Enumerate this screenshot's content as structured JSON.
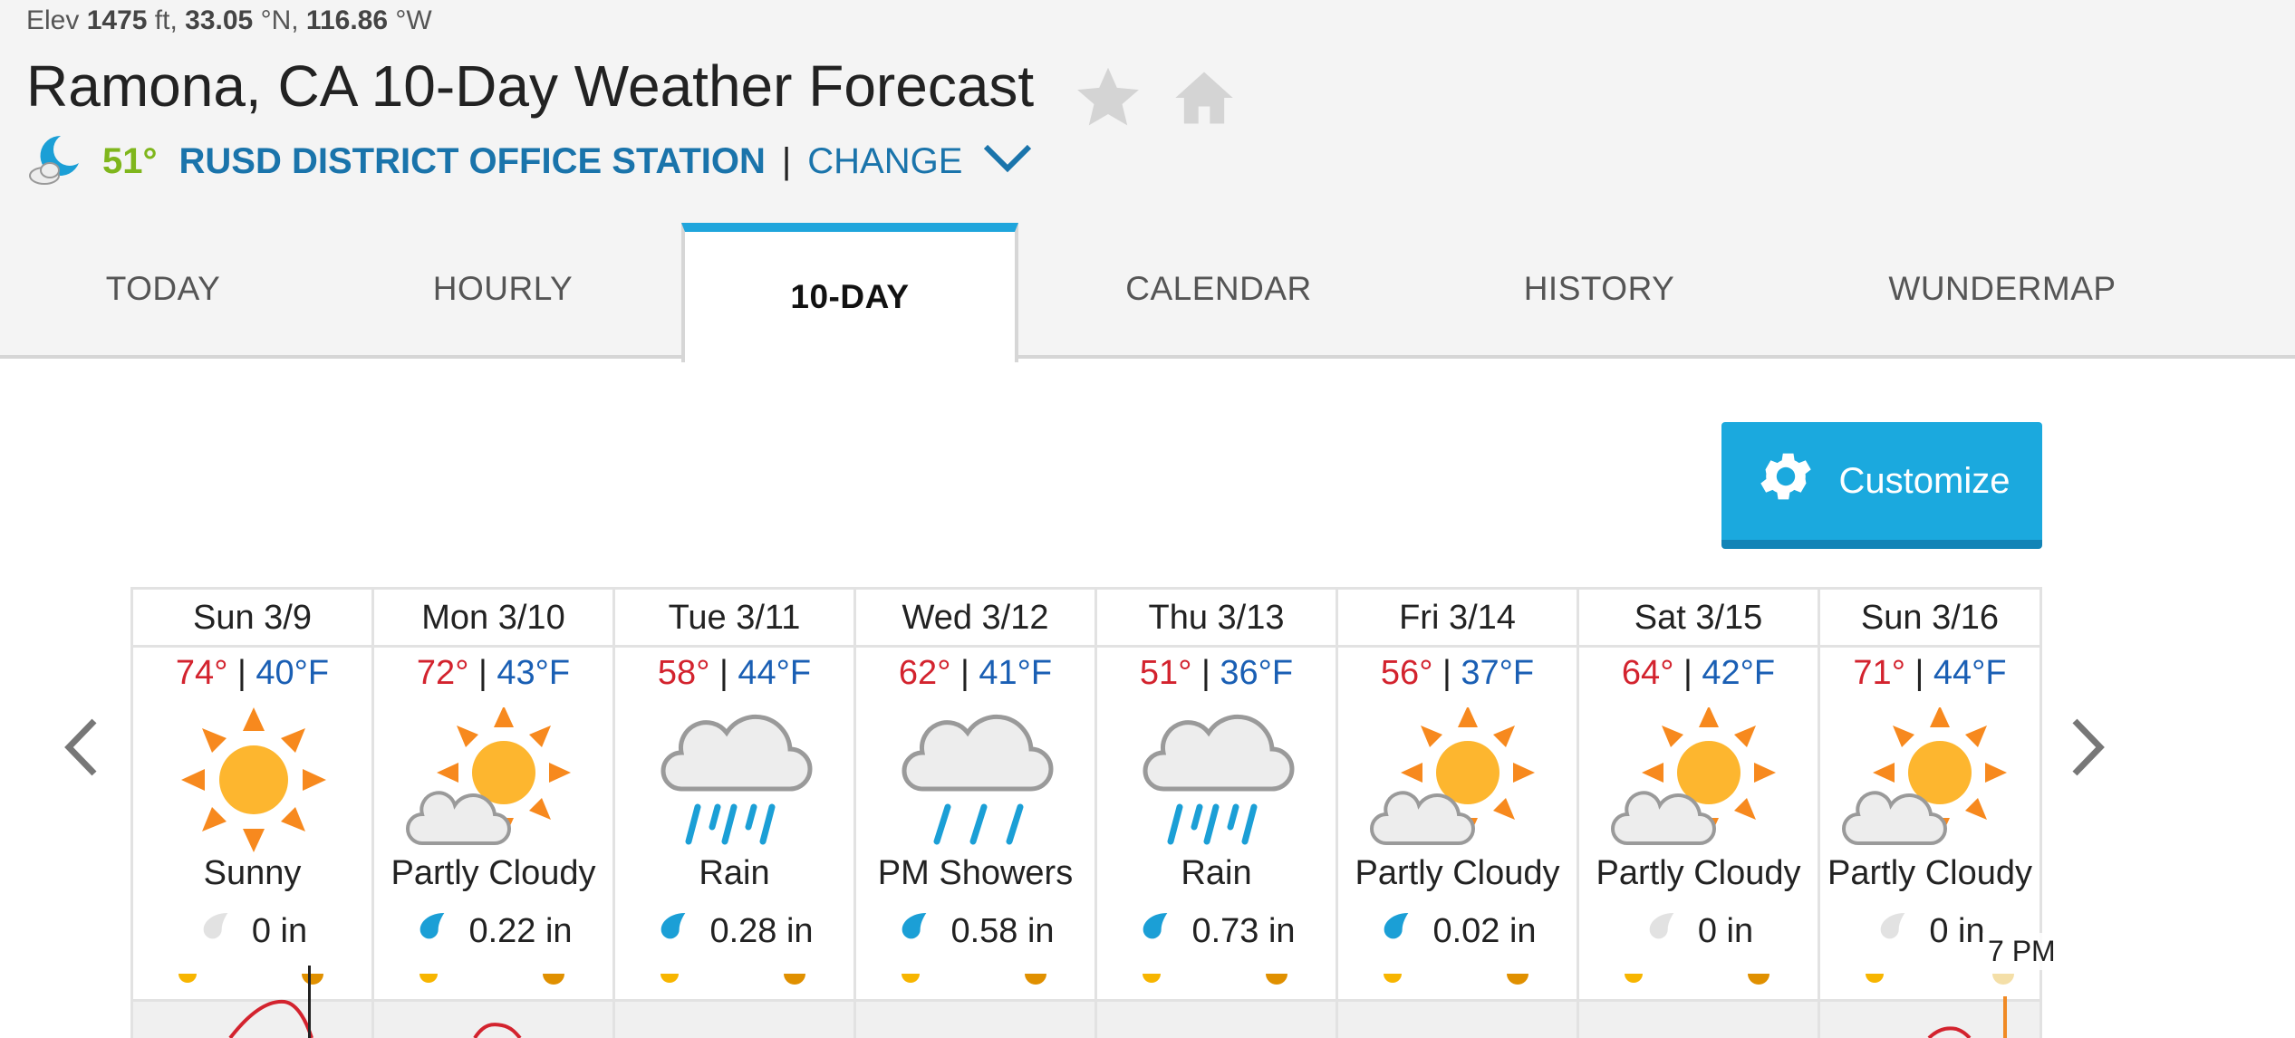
{
  "location": {
    "elev_label": "Elev",
    "elev_value": "1475",
    "elev_unit": "ft,",
    "lat_value": "33.05",
    "lat_unit": "°N,",
    "lon_value": "116.86",
    "lon_unit": "°W",
    "title": "Ramona, CA 10-Day Weather Forecast"
  },
  "station": {
    "current_temp": "51°",
    "name": "RUSD DISTRICT OFFICE STATION",
    "separator": "|",
    "change_label": "CHANGE"
  },
  "tabs": [
    {
      "label": "TODAY",
      "active": false
    },
    {
      "label": "HOURLY",
      "active": false
    },
    {
      "label": "10-DAY",
      "active": true
    },
    {
      "label": "CALENDAR",
      "active": false
    },
    {
      "label": "HISTORY",
      "active": false
    },
    {
      "label": "WUNDERMAP",
      "active": false
    }
  ],
  "customize_label": "Customize",
  "days": [
    {
      "date": "Sun 3/9",
      "high": "74°",
      "low": "40°F",
      "condition": "Sunny",
      "icon": "sunny-icon",
      "precip": "0 in",
      "wet": false
    },
    {
      "date": "Mon 3/10",
      "high": "72°",
      "low": "43°F",
      "condition": "Partly Cloudy",
      "icon": "partly-cloudy-icon",
      "precip": "0.22 in",
      "wet": true
    },
    {
      "date": "Tue 3/11",
      "high": "58°",
      "low": "44°F",
      "condition": "Rain",
      "icon": "rain-icon",
      "precip": "0.28 in",
      "wet": true
    },
    {
      "date": "Wed 3/12",
      "high": "62°",
      "low": "41°F",
      "condition": "PM Showers",
      "icon": "showers-icon",
      "precip": "0.58 in",
      "wet": true
    },
    {
      "date": "Thu 3/13",
      "high": "51°",
      "low": "36°F",
      "condition": "Rain",
      "icon": "rain-icon",
      "precip": "0.73 in",
      "wet": true
    },
    {
      "date": "Fri 3/14",
      "high": "56°",
      "low": "37°F",
      "condition": "Partly Cloudy",
      "icon": "partly-cloudy-icon",
      "precip": "0.02 in",
      "wet": true
    },
    {
      "date": "Sat 3/15",
      "high": "64°",
      "low": "42°F",
      "condition": "Partly Cloudy",
      "icon": "partly-cloudy-icon",
      "precip": "0 in",
      "wet": false
    },
    {
      "date": "Sun 3/16",
      "high": "71°",
      "low": "44°F",
      "condition": "Partly Cloudy",
      "icon": "partly-cloudy-icon",
      "precip": "0 in",
      "wet": false
    }
  ],
  "hover_time": "7 PM",
  "colors": {
    "accent": "#1fa5dc",
    "high_temp": "#d3232e",
    "low_temp": "#1a5fb4",
    "current_temp": "#7fb61c",
    "station_link": "#1a74ab"
  }
}
